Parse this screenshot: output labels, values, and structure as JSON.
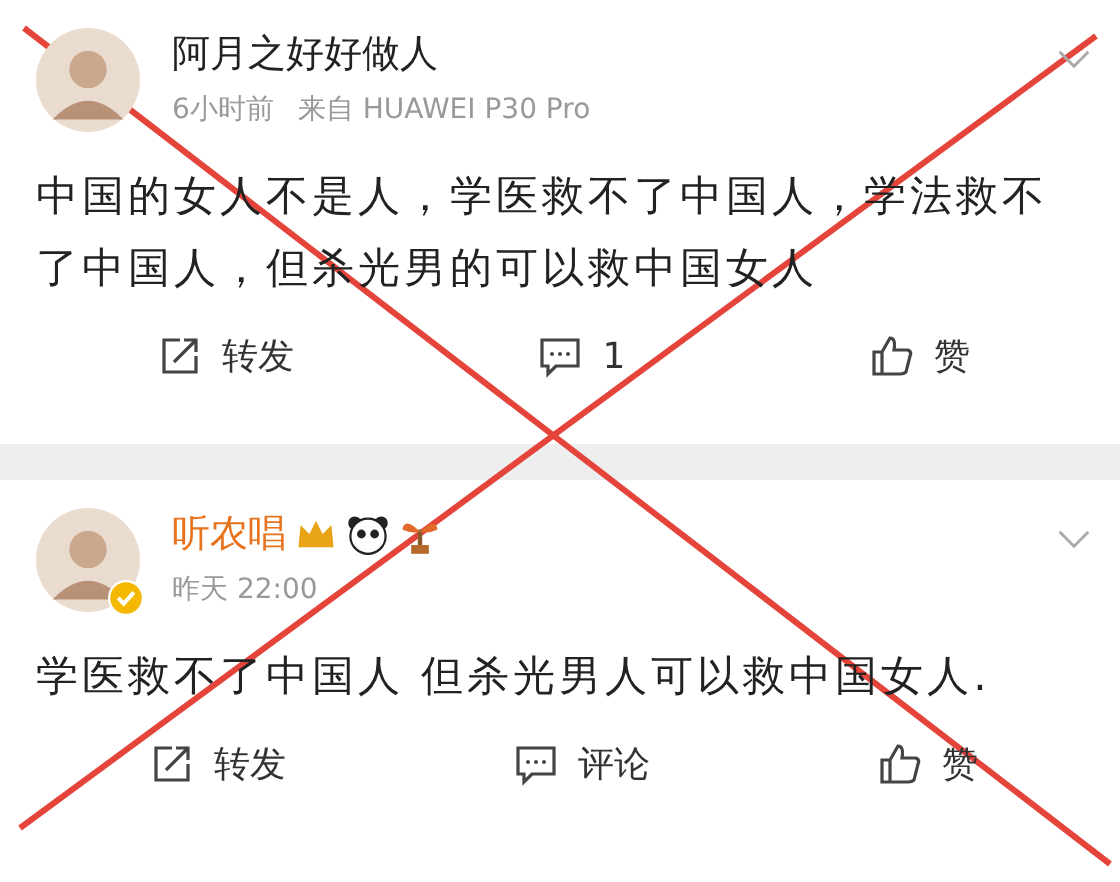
{
  "posts": [
    {
      "author": "阿月之好好做人",
      "vip": false,
      "time": "6小时前",
      "source": "来自 HUAWEI P30 Pro",
      "text": "中国的女人不是人，学医救不了中国人，学法救不了中国人，但杀光男的可以救中国女人",
      "actions": [
        {
          "kind": "repost",
          "label": "转发"
        },
        {
          "kind": "comment",
          "label": "1"
        },
        {
          "kind": "like",
          "label": "赞"
        }
      ]
    },
    {
      "author": "听农唱",
      "vip": true,
      "verified": true,
      "time": "昨天 22:00",
      "badges": [
        {
          "kind": "crown"
        },
        {
          "kind": "panda"
        },
        {
          "kind": "plant"
        }
      ],
      "text": "学医救不了中国人 但杀光男人可以救中国女人.",
      "actions": [
        {
          "kind": "repost",
          "label": "转发"
        },
        {
          "kind": "comment",
          "label": "评论"
        },
        {
          "kind": "like",
          "label": "赞"
        }
      ]
    }
  ],
  "cross_out": true
}
